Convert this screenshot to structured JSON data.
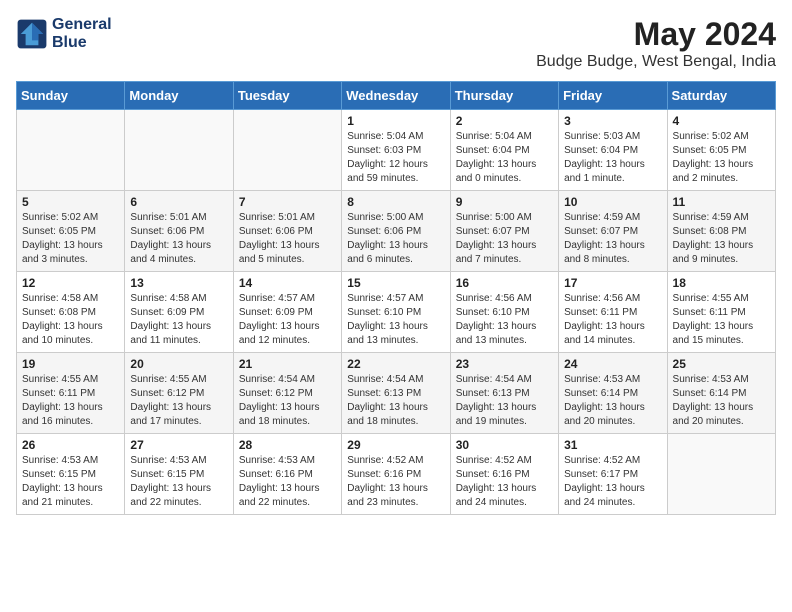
{
  "header": {
    "logo_line1": "General",
    "logo_line2": "Blue",
    "month_year": "May 2024",
    "location": "Budge Budge, West Bengal, India"
  },
  "days_of_week": [
    "Sunday",
    "Monday",
    "Tuesday",
    "Wednesday",
    "Thursday",
    "Friday",
    "Saturday"
  ],
  "weeks": [
    [
      {
        "day": "",
        "info": ""
      },
      {
        "day": "",
        "info": ""
      },
      {
        "day": "",
        "info": ""
      },
      {
        "day": "1",
        "info": "Sunrise: 5:04 AM\nSunset: 6:03 PM\nDaylight: 12 hours\nand 59 minutes."
      },
      {
        "day": "2",
        "info": "Sunrise: 5:04 AM\nSunset: 6:04 PM\nDaylight: 13 hours\nand 0 minutes."
      },
      {
        "day": "3",
        "info": "Sunrise: 5:03 AM\nSunset: 6:04 PM\nDaylight: 13 hours\nand 1 minute."
      },
      {
        "day": "4",
        "info": "Sunrise: 5:02 AM\nSunset: 6:05 PM\nDaylight: 13 hours\nand 2 minutes."
      }
    ],
    [
      {
        "day": "5",
        "info": "Sunrise: 5:02 AM\nSunset: 6:05 PM\nDaylight: 13 hours\nand 3 minutes."
      },
      {
        "day": "6",
        "info": "Sunrise: 5:01 AM\nSunset: 6:06 PM\nDaylight: 13 hours\nand 4 minutes."
      },
      {
        "day": "7",
        "info": "Sunrise: 5:01 AM\nSunset: 6:06 PM\nDaylight: 13 hours\nand 5 minutes."
      },
      {
        "day": "8",
        "info": "Sunrise: 5:00 AM\nSunset: 6:06 PM\nDaylight: 13 hours\nand 6 minutes."
      },
      {
        "day": "9",
        "info": "Sunrise: 5:00 AM\nSunset: 6:07 PM\nDaylight: 13 hours\nand 7 minutes."
      },
      {
        "day": "10",
        "info": "Sunrise: 4:59 AM\nSunset: 6:07 PM\nDaylight: 13 hours\nand 8 minutes."
      },
      {
        "day": "11",
        "info": "Sunrise: 4:59 AM\nSunset: 6:08 PM\nDaylight: 13 hours\nand 9 minutes."
      }
    ],
    [
      {
        "day": "12",
        "info": "Sunrise: 4:58 AM\nSunset: 6:08 PM\nDaylight: 13 hours\nand 10 minutes."
      },
      {
        "day": "13",
        "info": "Sunrise: 4:58 AM\nSunset: 6:09 PM\nDaylight: 13 hours\nand 11 minutes."
      },
      {
        "day": "14",
        "info": "Sunrise: 4:57 AM\nSunset: 6:09 PM\nDaylight: 13 hours\nand 12 minutes."
      },
      {
        "day": "15",
        "info": "Sunrise: 4:57 AM\nSunset: 6:10 PM\nDaylight: 13 hours\nand 13 minutes."
      },
      {
        "day": "16",
        "info": "Sunrise: 4:56 AM\nSunset: 6:10 PM\nDaylight: 13 hours\nand 13 minutes."
      },
      {
        "day": "17",
        "info": "Sunrise: 4:56 AM\nSunset: 6:11 PM\nDaylight: 13 hours\nand 14 minutes."
      },
      {
        "day": "18",
        "info": "Sunrise: 4:55 AM\nSunset: 6:11 PM\nDaylight: 13 hours\nand 15 minutes."
      }
    ],
    [
      {
        "day": "19",
        "info": "Sunrise: 4:55 AM\nSunset: 6:11 PM\nDaylight: 13 hours\nand 16 minutes."
      },
      {
        "day": "20",
        "info": "Sunrise: 4:55 AM\nSunset: 6:12 PM\nDaylight: 13 hours\nand 17 minutes."
      },
      {
        "day": "21",
        "info": "Sunrise: 4:54 AM\nSunset: 6:12 PM\nDaylight: 13 hours\nand 18 minutes."
      },
      {
        "day": "22",
        "info": "Sunrise: 4:54 AM\nSunset: 6:13 PM\nDaylight: 13 hours\nand 18 minutes."
      },
      {
        "day": "23",
        "info": "Sunrise: 4:54 AM\nSunset: 6:13 PM\nDaylight: 13 hours\nand 19 minutes."
      },
      {
        "day": "24",
        "info": "Sunrise: 4:53 AM\nSunset: 6:14 PM\nDaylight: 13 hours\nand 20 minutes."
      },
      {
        "day": "25",
        "info": "Sunrise: 4:53 AM\nSunset: 6:14 PM\nDaylight: 13 hours\nand 20 minutes."
      }
    ],
    [
      {
        "day": "26",
        "info": "Sunrise: 4:53 AM\nSunset: 6:15 PM\nDaylight: 13 hours\nand 21 minutes."
      },
      {
        "day": "27",
        "info": "Sunrise: 4:53 AM\nSunset: 6:15 PM\nDaylight: 13 hours\nand 22 minutes."
      },
      {
        "day": "28",
        "info": "Sunrise: 4:53 AM\nSunset: 6:16 PM\nDaylight: 13 hours\nand 22 minutes."
      },
      {
        "day": "29",
        "info": "Sunrise: 4:52 AM\nSunset: 6:16 PM\nDaylight: 13 hours\nand 23 minutes."
      },
      {
        "day": "30",
        "info": "Sunrise: 4:52 AM\nSunset: 6:16 PM\nDaylight: 13 hours\nand 24 minutes."
      },
      {
        "day": "31",
        "info": "Sunrise: 4:52 AM\nSunset: 6:17 PM\nDaylight: 13 hours\nand 24 minutes."
      },
      {
        "day": "",
        "info": ""
      }
    ]
  ]
}
